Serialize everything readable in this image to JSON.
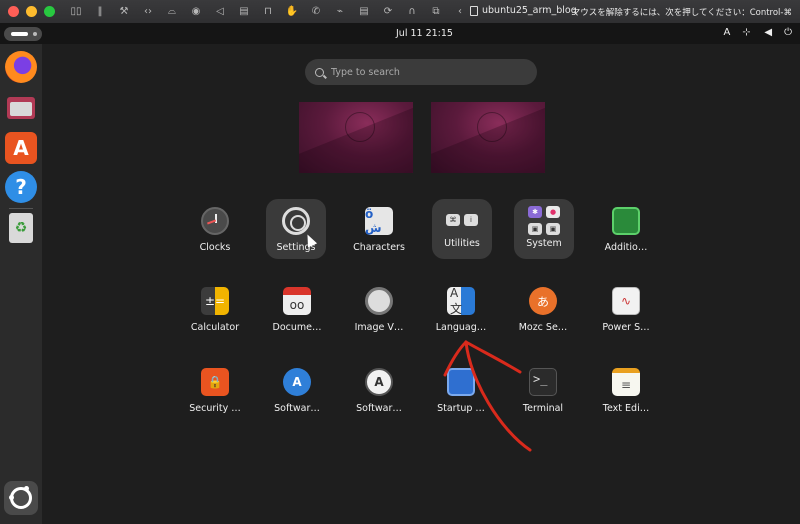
{
  "mac_window": {
    "title": "ubuntu25_arm_blog",
    "hint": "マウスを解除するには、次を押してください：Control-⌘",
    "traffic_lights": [
      "#ff5f57",
      "#febc2e",
      "#28c840"
    ]
  },
  "gnome_bar": {
    "clock": "Jul 11  21:15",
    "input_method": "A",
    "tray_icons": [
      "network-icon",
      "volume-icon",
      "power-icon"
    ]
  },
  "dock": {
    "items": [
      {
        "name": "Firefox",
        "icon": "firefox-icon"
      },
      {
        "name": "Files",
        "icon": "files-icon"
      },
      {
        "name": "App Center",
        "icon": "app-center-icon",
        "glyph": "A"
      },
      {
        "name": "Help",
        "icon": "help-icon",
        "glyph": "?"
      },
      {
        "name": "Trash",
        "icon": "trash-icon",
        "glyph": "♻"
      }
    ],
    "show_apps": {
      "icon": "ubuntu-logo-icon"
    }
  },
  "search": {
    "placeholder": "Type to search"
  },
  "apps": [
    {
      "label": "Clocks",
      "icon": "clock-icon"
    },
    {
      "label": "Settings",
      "icon": "gear-icon"
    },
    {
      "label": "Characters",
      "icon": "characters-icon",
      "glyph": "ö ش"
    },
    {
      "label": "Utilities",
      "icon": "folder-icon"
    },
    {
      "label": "System",
      "icon": "folder-icon"
    },
    {
      "label": "Additio…",
      "icon": "chip-icon"
    },
    {
      "label": "Calculator",
      "icon": "calculator-icon",
      "glyph": "±="
    },
    {
      "label": "Docume…",
      "icon": "document-viewer-icon",
      "glyph": "oo"
    },
    {
      "label": "Image V…",
      "icon": "image-viewer-icon"
    },
    {
      "label": "Languag…",
      "icon": "language-icon",
      "glyph": "A 文"
    },
    {
      "label": "Mozc Se…",
      "icon": "mozc-icon",
      "glyph": "あ"
    },
    {
      "label": "Power S…",
      "icon": "power-statistics-icon",
      "glyph": "∿"
    },
    {
      "label": "Security …",
      "icon": "security-icon",
      "glyph": "🔒"
    },
    {
      "label": "Softwar…",
      "icon": "software-updater-icon",
      "glyph": "A"
    },
    {
      "label": "Softwar…",
      "icon": "software-properties-icon",
      "glyph": "A"
    },
    {
      "label": "Startup …",
      "icon": "startup-disk-icon"
    },
    {
      "label": "Terminal",
      "icon": "terminal-icon",
      "glyph": ">_"
    },
    {
      "label": "Text Edi…",
      "icon": "text-editor-icon",
      "glyph": "≡"
    }
  ],
  "folder_minis": {
    "utilities": [
      "⌘",
      "i",
      "",
      ""
    ],
    "system": [
      "✱",
      "●",
      "▣",
      "▣"
    ]
  },
  "annotation": {
    "color": "#d92a1c"
  }
}
